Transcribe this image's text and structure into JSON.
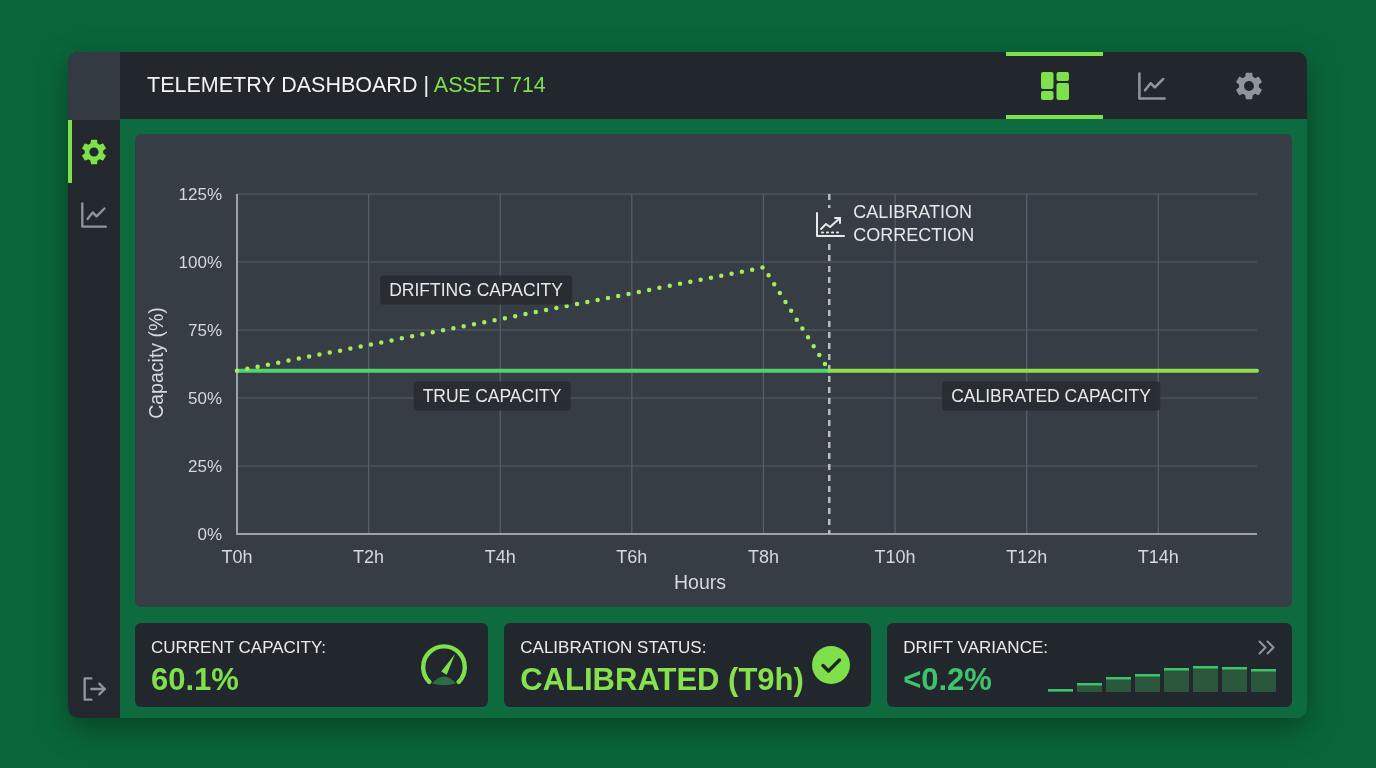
{
  "sidebar": {
    "items": [
      {
        "kind": "settings",
        "selected": true
      },
      {
        "kind": "chart",
        "selected": false
      }
    ],
    "footer_items": [
      {
        "kind": "logout"
      }
    ]
  },
  "header": {
    "title": "TELEMETRY DASHBOARD",
    "separator": "|",
    "asset": "ASSET 714",
    "tabs": [
      {
        "kind": "dashboard",
        "selected": true
      },
      {
        "kind": "chart",
        "selected": false
      },
      {
        "kind": "settings",
        "selected": false
      }
    ]
  },
  "chart_panel": {
    "chart_data": {
      "type": "line",
      "xlabel": "Hours",
      "ylabel": "Capacity (%)",
      "grid": true,
      "categories": [
        "T0h",
        null,
        null,
        null,
        "T2h",
        null,
        null,
        null,
        "T4h",
        null,
        null,
        null,
        "T6h",
        null,
        null,
        null,
        "T8h",
        null,
        null,
        null,
        "T10h",
        null,
        null,
        null,
        "T12h",
        null,
        null,
        null,
        "T14h",
        null,
        null,
        null
      ],
      "series": [
        {
          "name": "TRUE CAPACITY",
          "color": "#4fd36b",
          "line_style": "solid",
          "values": [
            60,
            60,
            60,
            60,
            60,
            60,
            60,
            60,
            60,
            60,
            60,
            60,
            60,
            60,
            60,
            60,
            60,
            60,
            60,
            null,
            null,
            null,
            null,
            null,
            null,
            null,
            null,
            null,
            null,
            null,
            null,
            null
          ]
        },
        {
          "name": "DRIFTING CAPACITY",
          "color": "#a6ea5e",
          "line_style": "dotted",
          "values": [
            60,
            62.4,
            64.8,
            67.1,
            69.5,
            71.9,
            74.3,
            76.6,
            79,
            81.4,
            83.8,
            86.1,
            88.5,
            90.9,
            93.3,
            95.6,
            98,
            79,
            60,
            null,
            null,
            null,
            null,
            null,
            null,
            null,
            null,
            null,
            null,
            null,
            null,
            null
          ]
        },
        {
          "name": "CALIBRATED CAPACITY",
          "color": "#8ee04e",
          "line_style": "solid",
          "values": [
            null,
            null,
            null,
            null,
            null,
            null,
            null,
            null,
            null,
            null,
            null,
            null,
            null,
            null,
            null,
            null,
            null,
            null,
            60,
            60,
            60,
            60,
            60,
            60,
            60,
            60,
            60,
            60,
            60,
            60,
            60,
            60
          ]
        }
      ],
      "ylim": [
        0,
        125
      ],
      "yticks": [
        {
          "value": 0,
          "label": "0%"
        },
        {
          "value": 25,
          "label": "25%"
        },
        {
          "value": 50,
          "label": "50%"
        },
        {
          "value": 75,
          "label": "75%"
        },
        {
          "value": 100,
          "label": "100%"
        },
        {
          "value": 125,
          "label": "125%"
        }
      ],
      "annotations": [
        {
          "text": "CALIBRATION CORRECTION"
        }
      ]
    }
  },
  "cards": [
    {
      "kind": "gauge",
      "label": "CURRENT CAPACITY:",
      "value": "60.1%"
    },
    {
      "kind": "status",
      "label": "CALIBRATION STATUS:",
      "value": "CALIBRATED (T9h)"
    },
    {
      "kind": "trend",
      "label": "DRIFT VARIANCE:",
      "value": "<0.2%"
    }
  ]
}
